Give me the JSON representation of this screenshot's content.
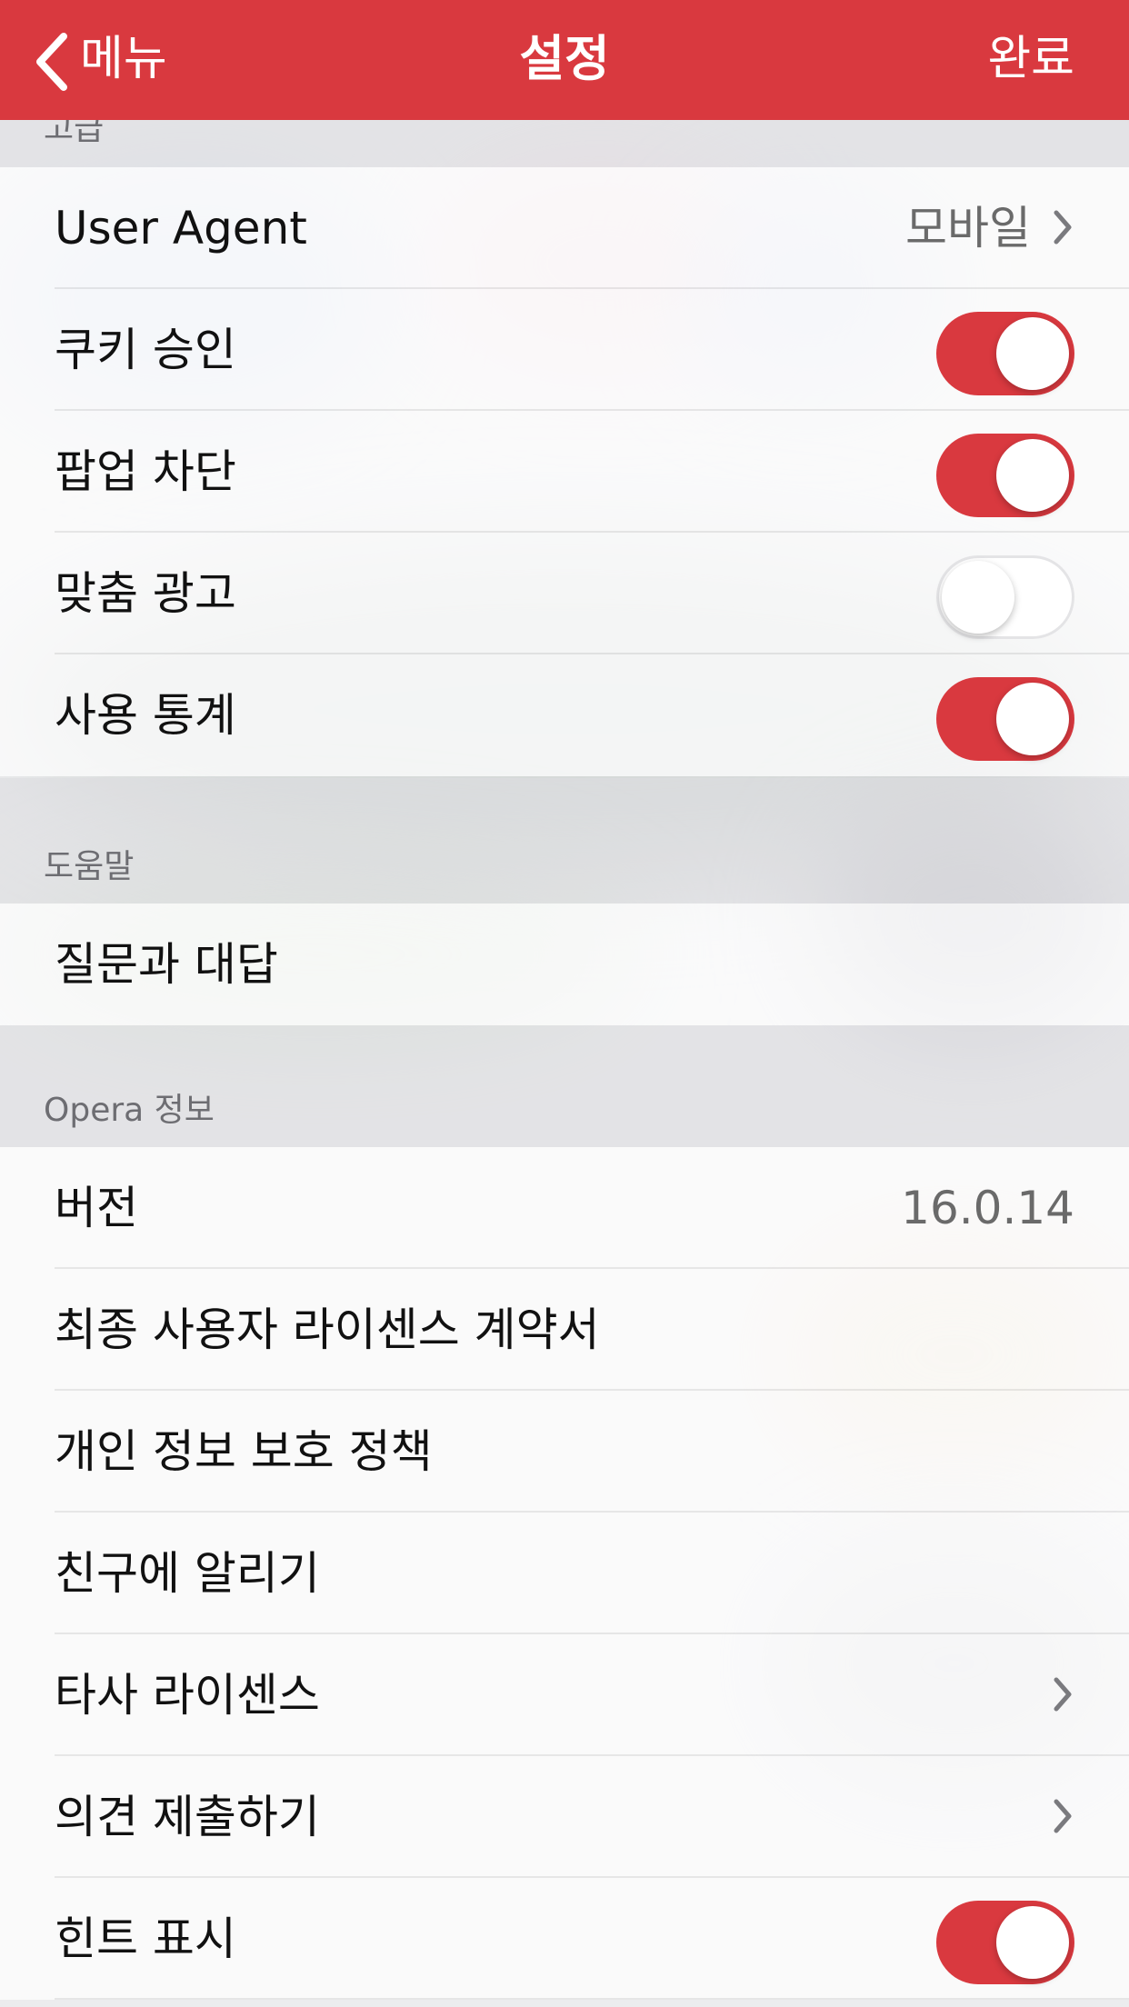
{
  "nav": {
    "back_label": "메뉴",
    "title": "설정",
    "done_label": "완료",
    "accent_color": "#d9393f"
  },
  "sections": {
    "advanced": {
      "header": "고급",
      "rows": {
        "user_agent": {
          "label": "User Agent",
          "value": "모바일"
        },
        "cookies": {
          "label": "쿠키 승인",
          "toggle": "on"
        },
        "popup_block": {
          "label": "팝업 차단",
          "toggle": "on"
        },
        "custom_ads": {
          "label": "맞춤 광고",
          "toggle": "off"
        },
        "usage_stats": {
          "label": "사용 통계",
          "toggle": "on"
        }
      }
    },
    "help": {
      "header": "도움말",
      "rows": {
        "faq": {
          "label": "질문과 대답"
        }
      }
    },
    "about": {
      "header": "Opera 정보",
      "rows": {
        "version": {
          "label": "버전",
          "value": "16.0.14"
        },
        "eula": {
          "label": "최종 사용자 라이센스 계약서"
        },
        "privacy": {
          "label": "개인 정보 보호 정책"
        },
        "tell_friends": {
          "label": "친구에 알리기"
        },
        "third_party": {
          "label": "타사 라이센스"
        },
        "feedback": {
          "label": "의견 제출하기"
        },
        "show_hints": {
          "label": "힌트 표시",
          "toggle": "on"
        }
      }
    }
  }
}
